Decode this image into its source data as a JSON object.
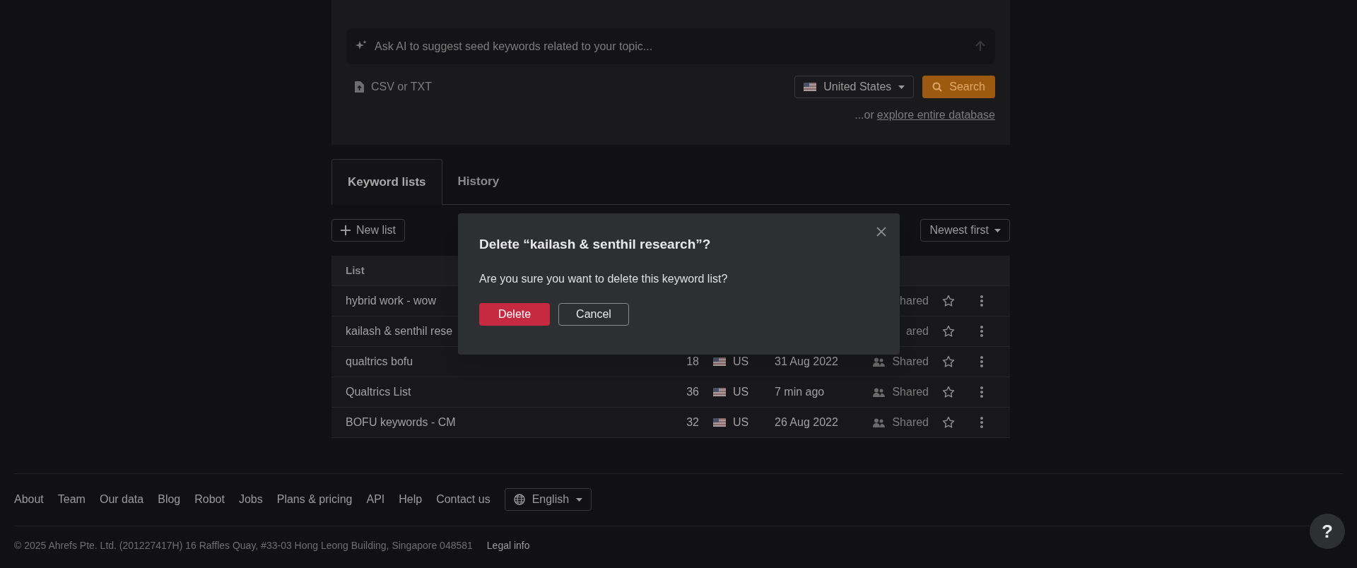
{
  "keyword_prompt": {
    "placeholder": "Ask AI to suggest seed keywords related to your topic..."
  },
  "upload": {
    "label": "CSV or TXT"
  },
  "country_select": {
    "value": "United States"
  },
  "search_button": {
    "label": "Search"
  },
  "explore": {
    "prefix": "...or",
    "link": "explore entire database"
  },
  "tabs": [
    {
      "label": "Keyword lists",
      "selected": true
    },
    {
      "label": "History",
      "selected": false
    }
  ],
  "new_list_button": {
    "label": "New list"
  },
  "sort_select": {
    "value": "Newest first"
  },
  "table": {
    "columns": [
      "List"
    ],
    "rows": [
      {
        "kind": "covered",
        "name": "hybrid work - wow",
        "shared": "hared"
      },
      {
        "kind": "covered",
        "name": "kailash & senthil rese",
        "shared": "ared"
      },
      {
        "kind": "full",
        "name": "qualtrics bofu",
        "count": "18",
        "country": "US",
        "updated": "31 Aug 2022",
        "shared": "Shared"
      },
      {
        "kind": "full",
        "name": "Qualtrics List",
        "count": "36",
        "country": "US",
        "updated": "7 min ago",
        "shared": "Shared"
      },
      {
        "kind": "full",
        "name": "BOFU keywords - CM",
        "count": "32",
        "country": "US",
        "updated": "26 Aug 2022",
        "shared": "Shared"
      }
    ]
  },
  "dialog": {
    "title": "Delete “kailash & senthil research”?",
    "message": "Are you sure you want to delete this keyword list?",
    "buttons": [
      {
        "label": "Delete",
        "kind": "primary"
      },
      {
        "label": "Cancel",
        "kind": "secondary"
      }
    ]
  },
  "footer": {
    "links": [
      "About",
      "Team",
      "Our data",
      "Blog",
      "Robot",
      "Jobs",
      "Plans & pricing",
      "API",
      "Help",
      "Contact us"
    ],
    "language": "English",
    "copyright": "© 2025 Ahrefs Pte. Ltd. (201227417H) 16 Raffles Quay, #33-03 Hong Leong Building, Singapore 048581",
    "legal": "Legal info"
  },
  "help_button": {
    "label": "?"
  }
}
